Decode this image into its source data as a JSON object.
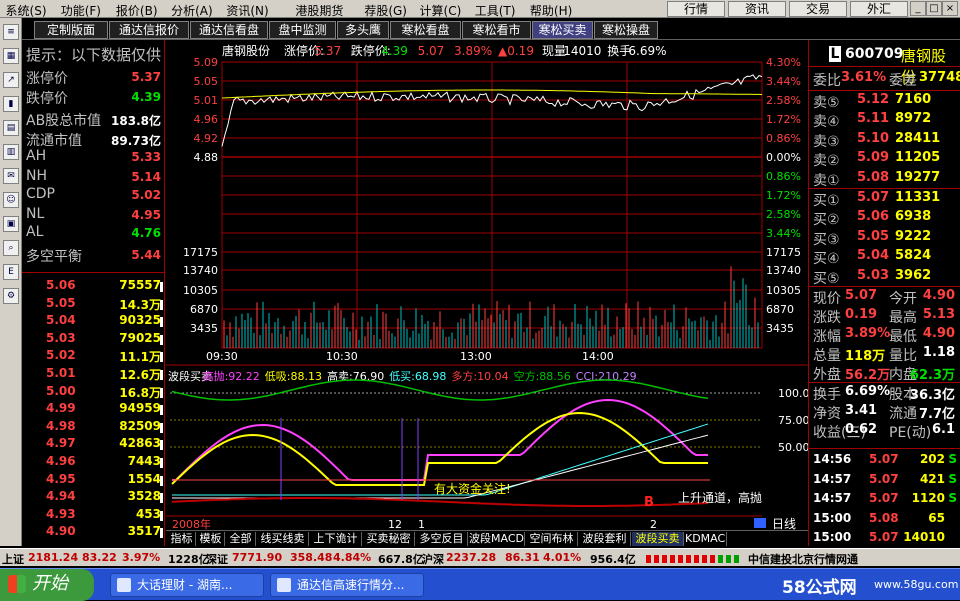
{
  "menu": {
    "items": [
      "系统(S)",
      "功能(F)",
      "报价(B)",
      "分析(A)",
      "资讯(N)",
      "港股期货",
      "荐股(G)",
      "计算(C)",
      "工具(T)",
      "帮助(H)"
    ],
    "right_buttons": [
      "行情",
      "资讯",
      "交易",
      "外汇"
    ]
  },
  "tabs": [
    "定制版面",
    "通达信报价",
    "通达信看盘",
    "盘中监测",
    "多头鹰",
    "寒松看盘",
    "寒松看市",
    "寒松买卖",
    "寒松操盘"
  ],
  "active_tab": 7,
  "left": {
    "hint": "提示：以下数据仅供",
    "rows": [
      {
        "label": "涨停价",
        "value": "5.37",
        "color": "#ff4040"
      },
      {
        "label": "跌停价",
        "value": "4.39",
        "color": "#00e000"
      },
      {
        "label": "AB股总市值",
        "value": "183.8亿",
        "color": "#ffffff"
      },
      {
        "label": "流通市值",
        "value": "89.73亿",
        "color": "#ffffff"
      },
      {
        "label": "AH",
        "value": "5.33",
        "color": "#ff4040"
      },
      {
        "label": "NH",
        "value": "5.14",
        "color": "#ff4040"
      },
      {
        "label": "CDP",
        "value": "5.02",
        "color": "#ff4040"
      },
      {
        "label": "NL",
        "value": "4.95",
        "color": "#ff4040"
      },
      {
        "label": "AL",
        "value": "4.76",
        "color": "#00e000"
      },
      {
        "label": "多空平衡",
        "value": "5.44",
        "color": "#ff4040"
      }
    ],
    "price_table": [
      {
        "p": "5.06",
        "v": "75557"
      },
      {
        "p": "5.05",
        "v": "14.3万"
      },
      {
        "p": "5.04",
        "v": "90325"
      },
      {
        "p": "5.03",
        "v": "79025"
      },
      {
        "p": "5.02",
        "v": "11.1万"
      },
      {
        "p": "5.01",
        "v": "12.6万"
      },
      {
        "p": "5.00",
        "v": "16.8万"
      },
      {
        "p": "4.99",
        "v": "94959"
      },
      {
        "p": "4.98",
        "v": "82509"
      },
      {
        "p": "4.97",
        "v": "42863"
      },
      {
        "p": "4.96",
        "v": "7443"
      },
      {
        "p": "4.95",
        "v": "1554"
      },
      {
        "p": "4.94",
        "v": "3528"
      },
      {
        "p": "4.93",
        "v": "453"
      },
      {
        "p": "4.90",
        "v": "3517"
      }
    ]
  },
  "chart": {
    "stock_name": "唐钢股份",
    "header": [
      {
        "t": "涨停价:",
        "c": "#ffffff"
      },
      {
        "t": "5.37",
        "c": "#ff4040"
      },
      {
        "t": "跌停价:",
        "c": "#ffffff"
      },
      {
        "t": "4.39",
        "c": "#00e000"
      },
      {
        "t": "5.07",
        "c": "#ff4040"
      },
      {
        "t": "3.89%",
        "c": "#ff4040"
      },
      {
        "t": "▲0.19",
        "c": "#ff4040"
      },
      {
        "t": "现量",
        "c": "#ffffff"
      },
      {
        "t": "14010",
        "c": "#ffffff"
      },
      {
        "t": "换手",
        "c": "#ffffff"
      },
      {
        "t": "6.69%",
        "c": "#ffffff"
      }
    ],
    "price_ticks": [
      "5.09",
      "5.05",
      "5.01",
      "4.96",
      "4.92",
      "4.88",
      "",
      "",
      "",
      "",
      "",
      ""
    ],
    "left_ticks": [
      "5.09",
      "5.05",
      "5.01",
      "4.96",
      "4.92",
      "4.88"
    ],
    "pct_ticks": [
      "4.30%",
      "3.44%",
      "2.58%",
      "1.72%",
      "0.86%",
      "0.00%",
      "0.86%",
      "1.72%",
      "2.58%",
      "3.44%"
    ],
    "vol_ticks": [
      "17175",
      "13740",
      "10305",
      "6870",
      "3435"
    ],
    "time_ticks": [
      "09:30",
      "10:30",
      "13:00",
      "14:00"
    ],
    "ind_header": [
      {
        "t": "波段买卖",
        "c": "#ffffff"
      },
      {
        "t": "高抛:92.22",
        "c": "#ff40ff"
      },
      {
        "t": "低吸:88.13",
        "c": "#ffff00"
      },
      {
        "t": "高卖:76.90",
        "c": "#ffffff"
      },
      {
        "t": "低买:68.98",
        "c": "#40ffff"
      },
      {
        "t": "多方:10.04",
        "c": "#ff4040"
      },
      {
        "t": "空方:88.56",
        "c": "#00c000"
      },
      {
        "t": "CCI:210.29",
        "c": "#c080ff"
      }
    ],
    "ind_ticks": [
      "100.0",
      "75.00",
      "50.00"
    ],
    "annotations": [
      "有大资金关注!",
      "上升通道，高抛",
      "B"
    ],
    "date_label": "2008年",
    "date_ticks": [
      "12",
      "1",
      "2"
    ],
    "period": "日线",
    "bottom_tabs": [
      "指标",
      "模板",
      "全部",
      "线买线卖",
      "上下诡计",
      "买卖秘密",
      "多空反目",
      "波段MACD",
      "空间布林",
      "波段套利",
      "波段买卖",
      "KDMACD"
    ],
    "bottom_active": 10
  },
  "right": {
    "code": "600709",
    "name": "唐钢股份",
    "weibi_label": "委比",
    "weibi": "3.61%",
    "weicha_label": "委差",
    "weicha": "37748",
    "sells": [
      {
        "l": "卖⑤",
        "p": "5.12",
        "v": "7160"
      },
      {
        "l": "卖④",
        "p": "5.11",
        "v": "8972"
      },
      {
        "l": "卖③",
        "p": "5.10",
        "v": "28411"
      },
      {
        "l": "卖②",
        "p": "5.09",
        "v": "11205"
      },
      {
        "l": "卖①",
        "p": "5.08",
        "v": "19277"
      }
    ],
    "buys": [
      {
        "l": "买①",
        "p": "5.07",
        "v": "11331"
      },
      {
        "l": "买②",
        "p": "5.06",
        "v": "6938"
      },
      {
        "l": "买③",
        "p": "5.05",
        "v": "9222"
      },
      {
        "l": "买④",
        "p": "5.04",
        "v": "5824"
      },
      {
        "l": "买⑤",
        "p": "5.03",
        "v": "3962"
      }
    ],
    "stats": [
      {
        "a": "现价",
        "av": "5.07",
        "b": "今开",
        "bv": "4.90"
      },
      {
        "a": "涨跌",
        "av": "0.19",
        "b": "最高",
        "bv": "5.13"
      },
      {
        "a": "涨幅",
        "av": "3.89%",
        "b": "最低",
        "bv": "4.90"
      },
      {
        "a": "总量",
        "av": "118万",
        "b": "量比",
        "bv": "1.18"
      },
      {
        "a": "外盘",
        "av": "56.2万",
        "b": "内盘",
        "bv": "62.3万"
      }
    ],
    "stats2": [
      {
        "a": "换手",
        "av": "6.69%",
        "b": "股本",
        "bv": "36.3亿"
      },
      {
        "a": "净资",
        "av": "3.41",
        "b": "流通",
        "bv": "7.7亿"
      },
      {
        "a": "收益(三)",
        "av": "0.62",
        "b": "PE(动)",
        "bv": "6.1"
      }
    ],
    "ticks": [
      {
        "t": "14:56",
        "p": "5.07",
        "v": "202",
        "s": "S"
      },
      {
        "t": "14:57",
        "p": "5.07",
        "v": "421",
        "s": "S"
      },
      {
        "t": "14:57",
        "p": "5.07",
        "v": "1120",
        "s": "S"
      },
      {
        "t": "15:00",
        "p": "5.08",
        "v": "65",
        "s": ""
      },
      {
        "t": "15:00",
        "p": "5.07",
        "v": "14010",
        "s": ""
      }
    ]
  },
  "status": {
    "sh_label": "上证",
    "sh": "2181.24",
    "sh_chg": "83.22",
    "sh_pct": "3.97%",
    "sh_amt": "1228亿",
    "sz_label": "深证",
    "sz": "7771.90",
    "sz_chg": "358.48",
    "sz_pct": "4.84%",
    "sz_amt": "667.8亿",
    "hs_label": "沪深",
    "hs": "2237.28",
    "hs_chg": "86.31",
    "hs_pct": "4.01%",
    "hs_amt": "956.4亿",
    "broker": "中信建投北京行情网通"
  },
  "taskbar": {
    "start": "开始",
    "tasks": [
      "大话理财 - 湖南...",
      "通达信高速行情分..."
    ],
    "logo": "58公式网",
    "logo_url": "www.58gu.com"
  }
}
